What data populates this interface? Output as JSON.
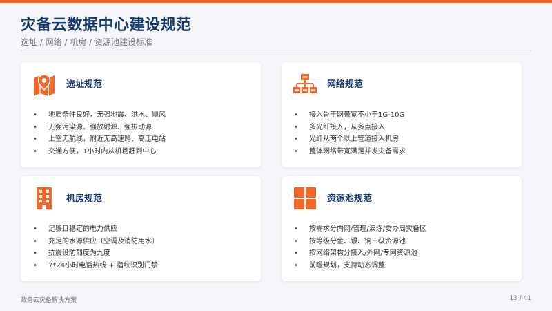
{
  "header": {
    "title": "灾备云数据中心建设规范",
    "breadcrumb": "选址 / 网络 / 机房 / 资源池建设标准"
  },
  "colors": {
    "accent": "#f0692b",
    "title": "#163a6b"
  },
  "cards": [
    {
      "title": "选址规范",
      "icon": "map-pin-icon",
      "items": [
        "地质条件良好，无强地震、洪水、飓风",
        "无强污染源、强放射源、强振动源",
        "上空无航线，附近无高速路、高压电站",
        "交通方便，1小时内从机场赶到中心"
      ]
    },
    {
      "title": "网络规范",
      "icon": "network-icon",
      "items": [
        "接入骨干网带宽不小于1G-10G",
        "多光纤接入，从多点接入",
        "光纤从两个以上管道接入机房",
        "整体网络带宽满足并发灾备需求"
      ]
    },
    {
      "title": "机房规范",
      "icon": "building-icon",
      "items": [
        "足够且稳定的电力供应",
        "充足的水源供应（空调及消防用水）",
        "抗震设防烈度为九度",
        "7*24小时电话热线 + 指纹识别门禁"
      ]
    },
    {
      "title": "资源池规范",
      "icon": "grid-icon",
      "items": [
        "按需求分内网/管理/演练/委办局灾备区",
        "按等级分金、银、铜三级资源池",
        "按网络架构分接入/外网/专网资源池",
        "前瞻规划，支持动态调整"
      ]
    }
  ],
  "footer": {
    "left": "政务云灾备解决方案",
    "page": "13 / 41"
  }
}
